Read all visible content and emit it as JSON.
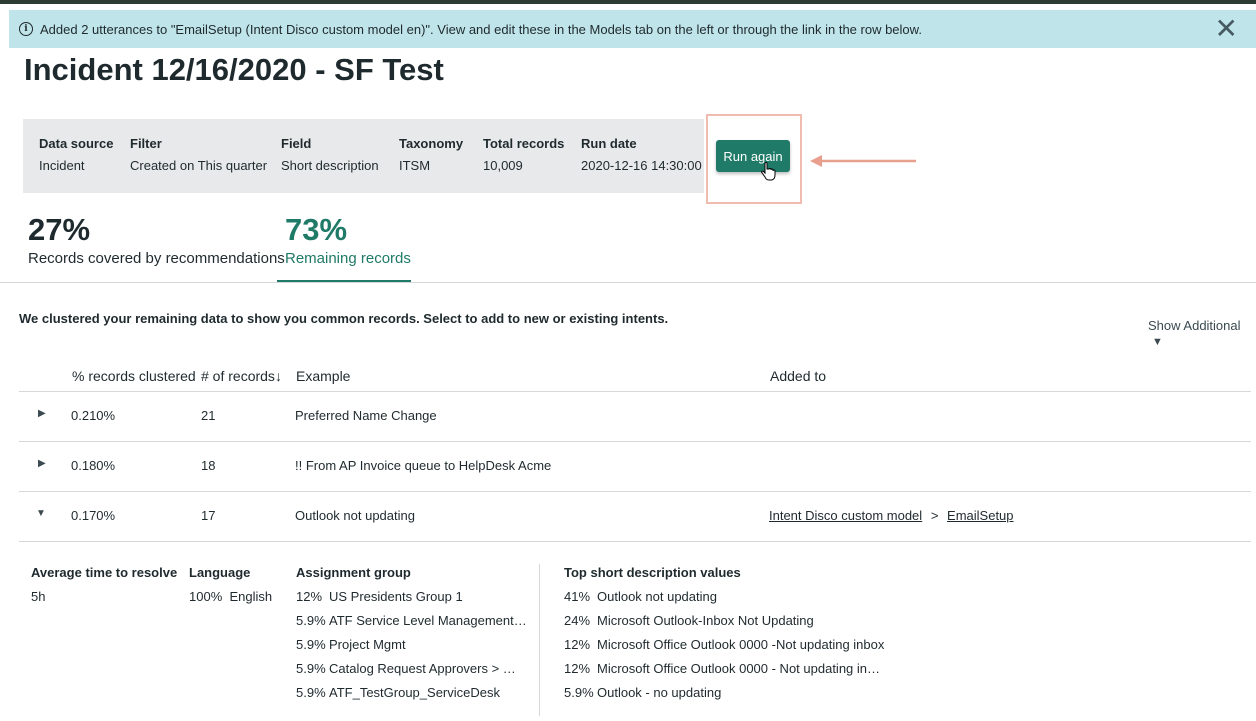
{
  "banner": {
    "icon": "info-icon",
    "text": "Added 2 utterances to \"EmailSetup (Intent Disco custom model en)\". View and edit these in the Models tab on the left or through the link in the row below.",
    "close_icon": "close-icon",
    "close_label": "✕"
  },
  "page_title": "Incident 12/16/2020 - SF Test",
  "summary": {
    "data_source": {
      "label": "Data source",
      "value": "Incident"
    },
    "filter": {
      "label": "Filter",
      "value": "Created on This quarter"
    },
    "field": {
      "label": "Field",
      "value": "Short description"
    },
    "taxonomy": {
      "label": "Taxonomy",
      "value": "ITSM"
    },
    "total_records": {
      "label": "Total records",
      "value": "10,009"
    },
    "run_date": {
      "label": "Run date",
      "value": "2020-12-16 14:30:00"
    }
  },
  "run_again_label": "Run again",
  "tabs": [
    {
      "value": "27%",
      "label": "Records covered by recommendations"
    },
    {
      "value": "73%",
      "label": "Remaining records",
      "active": true
    }
  ],
  "clustered_text": "We clustered your remaining data to show you common records. Select to add to new or existing intents.",
  "show_additional": "Show Additional",
  "table": {
    "headers": [
      "% records clustered",
      "# of records",
      "Example",
      "Added to"
    ],
    "rows": [
      {
        "pct": "0.210%",
        "count": "21",
        "example": "Preferred Name Change",
        "expanded": false
      },
      {
        "pct": "0.180%",
        "count": "18",
        "example": "!! From AP Invoice queue to HelpDesk Acme",
        "expanded": false
      },
      {
        "pct": "0.170%",
        "count": "17",
        "example": "Outlook not updating",
        "expanded": true,
        "added_to": {
          "model": "Intent Disco custom model",
          "sep": ">",
          "intent": "EmailSetup"
        }
      }
    ]
  },
  "details": {
    "avg_time": {
      "label": "Average time to resolve",
      "value": "5h"
    },
    "language": {
      "label": "Language",
      "pct": "100%",
      "value": "English"
    },
    "assignment": {
      "label": "Assignment group",
      "items": [
        {
          "pct": "12%",
          "name": "US Presidents Group 1"
        },
        {
          "pct": "5.9%",
          "name": "ATF Service Level Management…"
        },
        {
          "pct": "5.9%",
          "name": "Project Mgmt"
        },
        {
          "pct": "5.9%",
          "name": "Catalog Request Approvers > …"
        },
        {
          "pct": "5.9%",
          "name": "ATF_TestGroup_ServiceDesk"
        }
      ]
    },
    "top_values": {
      "label": "Top short description values",
      "items": [
        {
          "pct": "41%",
          "name": "Outlook not updating"
        },
        {
          "pct": "24%",
          "name": "Microsoft Outlook-Inbox Not Updating"
        },
        {
          "pct": "12%",
          "name": "Microsoft Office Outlook 0000 -Not updating inbox"
        },
        {
          "pct": "12%",
          "name": "Microsoft Office Outlook 0000 - Not updating in…"
        },
        {
          "pct": "5.9%",
          "name": "Outlook - no updating"
        }
      ]
    }
  },
  "colors": {
    "accent": "#1f7a67",
    "banner": "#bfe4ea",
    "highlight": "#efbcaf"
  }
}
